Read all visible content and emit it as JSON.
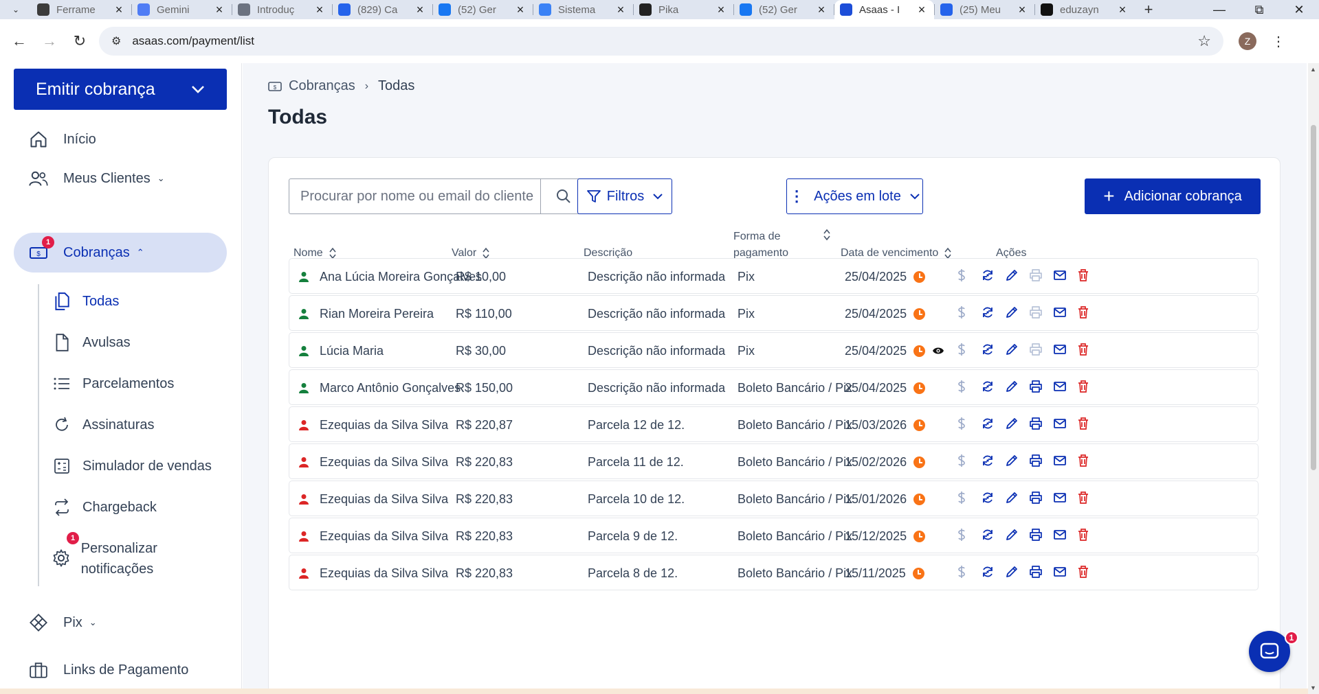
{
  "browser": {
    "tabs": [
      {
        "title": "Ferrame",
        "favicon_color": "#3c3c3c",
        "active": false
      },
      {
        "title": "Gemini",
        "favicon_color": "#4f7cf5",
        "active": false
      },
      {
        "title": "Introduç",
        "favicon_color": "#6b7280",
        "active": false
      },
      {
        "title": "(829) Ca",
        "favicon_color": "#2563eb",
        "active": false
      },
      {
        "title": "(52) Ger",
        "favicon_color": "#1877f2",
        "active": false
      },
      {
        "title": "Sistema",
        "favicon_color": "#3b82f6",
        "active": false
      },
      {
        "title": "Pika",
        "favicon_color": "#222222",
        "active": false
      },
      {
        "title": "(52) Ger",
        "favicon_color": "#1877f2",
        "active": false
      },
      {
        "title": "Asaas - I",
        "favicon_color": "#1d4ed8",
        "active": true
      },
      {
        "title": "(25) Meu",
        "favicon_color": "#2563eb",
        "active": false
      },
      {
        "title": "eduzayn",
        "favicon_color": "#111111",
        "active": false
      }
    ],
    "url": "asaas.com/payment/list",
    "profile_initial": "Z"
  },
  "sidebar": {
    "emit_button": "Emitir cobrança",
    "items": [
      {
        "label": "Início",
        "icon": "home-icon"
      },
      {
        "label": "Meus Clientes",
        "icon": "users-icon"
      },
      {
        "label": "Cobranças",
        "icon": "billing-icon",
        "badge": "1"
      },
      {
        "label": "Pix",
        "icon": "pix-icon"
      },
      {
        "label": "Links de Pagamento",
        "icon": "briefcase-icon"
      }
    ],
    "subitems": [
      {
        "label": "Todas",
        "icon": "documents-icon"
      },
      {
        "label": "Avulsas",
        "icon": "document-icon"
      },
      {
        "label": "Parcelamentos",
        "icon": "list-icon"
      },
      {
        "label": "Assinaturas",
        "icon": "refresh-icon"
      },
      {
        "label": "Simulador de vendas",
        "icon": "calculator-icon"
      },
      {
        "label": "Chargeback",
        "icon": "swap-icon"
      },
      {
        "label": "Personalizar notificações",
        "icon": "gear-icon",
        "badge": "1"
      }
    ]
  },
  "main": {
    "breadcrumb": {
      "root": "Cobranças",
      "current": "Todas"
    },
    "title": "Todas",
    "search_placeholder": "Procurar por nome ou email do cliente",
    "filters_label": "Filtros",
    "bulk_actions_label": "Ações em lote",
    "add_label": "Adicionar cobrança",
    "columns": {
      "name": "Nome",
      "value": "Valor",
      "description": "Descrição",
      "payment_method": "Forma de pagamento",
      "due_date": "Data de vencimento",
      "actions": "Ações"
    },
    "rows": [
      {
        "name": "Ana Lúcia Moreira Gonçalves",
        "value": "R$ 10,00",
        "description": "Descrição não informada",
        "method": "Pix",
        "due": "25/04/2025",
        "status_color": "#15803d",
        "viewed": false,
        "print_enabled": false
      },
      {
        "name": "Rian Moreira Pereira",
        "value": "R$ 110,00",
        "description": "Descrição não informada",
        "method": "Pix",
        "due": "25/04/2025",
        "status_color": "#15803d",
        "viewed": false,
        "print_enabled": false
      },
      {
        "name": "Lúcia Maria",
        "value": "R$ 30,00",
        "description": "Descrição não informada",
        "method": "Pix",
        "due": "25/04/2025",
        "status_color": "#15803d",
        "viewed": true,
        "print_enabled": false
      },
      {
        "name": "Marco Antônio Gonçalves",
        "value": "R$ 150,00",
        "description": "Descrição não informada",
        "method": "Boleto Bancário / Pix",
        "due": "25/04/2025",
        "status_color": "#15803d",
        "viewed": false,
        "print_enabled": true
      },
      {
        "name": "Ezequias da Silva Silva",
        "value": "R$ 220,87",
        "description": "Parcela 12 de 12.",
        "method": "Boleto Bancário / Pix",
        "due": "15/03/2026",
        "status_color": "#dc2626",
        "viewed": false,
        "print_enabled": true
      },
      {
        "name": "Ezequias da Silva Silva",
        "value": "R$ 220,83",
        "description": "Parcela 11 de 12.",
        "method": "Boleto Bancário / Pix",
        "due": "15/02/2026",
        "status_color": "#dc2626",
        "viewed": false,
        "print_enabled": true
      },
      {
        "name": "Ezequias da Silva Silva",
        "value": "R$ 220,83",
        "description": "Parcela 10 de 12.",
        "method": "Boleto Bancário / Pix",
        "due": "15/01/2026",
        "status_color": "#dc2626",
        "viewed": false,
        "print_enabled": true
      },
      {
        "name": "Ezequias da Silva Silva",
        "value": "R$ 220,83",
        "description": "Parcela 9 de 12.",
        "method": "Boleto Bancário / Pix",
        "due": "15/12/2025",
        "status_color": "#dc2626",
        "viewed": false,
        "print_enabled": true
      },
      {
        "name": "Ezequias da Silva Silva",
        "value": "R$ 220,83",
        "description": "Parcela 8 de 12.",
        "method": "Boleto Bancário / Pix",
        "due": "15/11/2025",
        "status_color": "#dc2626",
        "viewed": false,
        "print_enabled": true
      }
    ]
  },
  "chat": {
    "badge": "1"
  },
  "colors": {
    "primary": "#0a2fb3",
    "active_bg": "#d8e0f5",
    "warning": "#f97316",
    "danger": "#dc2626"
  }
}
